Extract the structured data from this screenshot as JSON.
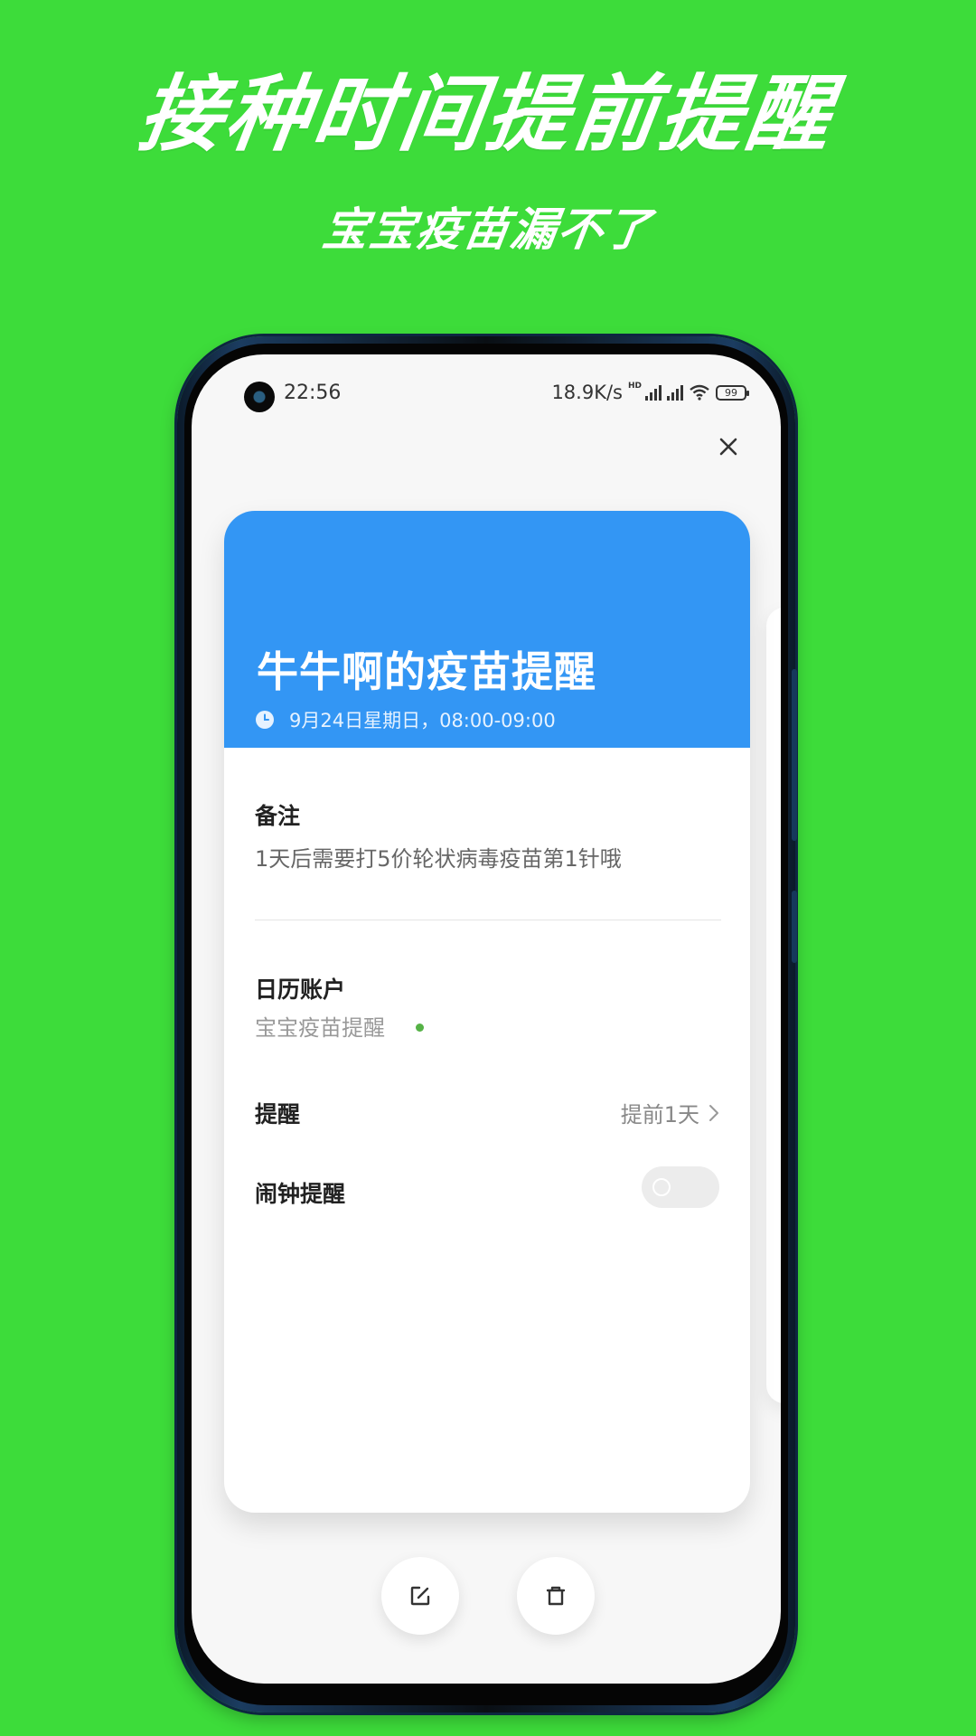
{
  "promo": {
    "headline": "接种时间提前提醒",
    "subheadline": "宝宝疫苗漏不了"
  },
  "status_bar": {
    "time": "22:56",
    "network_speed": "18.9K/s",
    "hd_label": "HD",
    "battery": "99"
  },
  "event": {
    "title": "牛牛啊的疫苗提醒",
    "datetime": "9月24日星期日，08:00-09:00",
    "header_color": "#3396f4"
  },
  "note": {
    "label": "备注",
    "text": "1天后需要打5价轮状病毒疫苗第1针哦"
  },
  "calendar_account": {
    "label": "日历账户",
    "value": "宝宝疫苗提醒",
    "dot_color": "#55b246"
  },
  "reminder": {
    "label": "提醒",
    "value": "提前1天"
  },
  "alarm": {
    "label": "闹钟提醒",
    "enabled": false
  },
  "icons": {
    "close": "close-icon",
    "clock": "clock-icon",
    "chevron": "chevron-right-icon",
    "edit": "edit-icon",
    "delete": "trash-icon"
  },
  "colors": {
    "background": "#3ddc3a"
  }
}
